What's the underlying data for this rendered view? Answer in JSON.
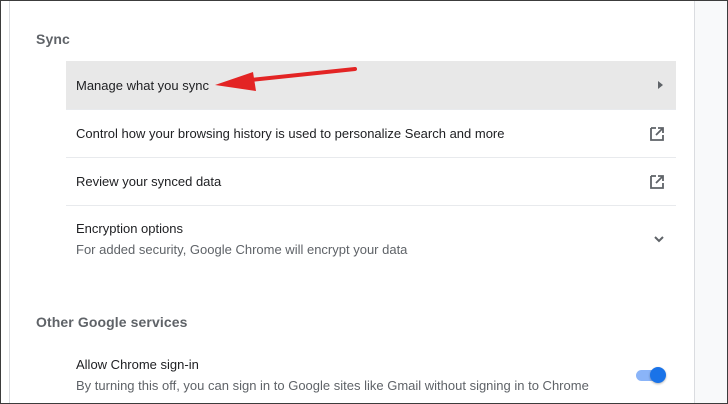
{
  "sync": {
    "heading": "Sync",
    "items": [
      {
        "label": "Manage what you sync",
        "icon": "chevron-right-icon"
      },
      {
        "label": "Control how your browsing history is used to personalize Search and more",
        "icon": "open-in-new-icon"
      },
      {
        "label": "Review your synced data",
        "icon": "open-in-new-icon"
      },
      {
        "label": "Encryption options",
        "sublabel": "For added security, Google Chrome will encrypt your data",
        "icon": "chevron-down-icon"
      }
    ]
  },
  "other_services": {
    "heading": "Other Google services",
    "items": [
      {
        "label": "Allow Chrome sign-in",
        "sublabel": "By turning this off, you can sign in to Google sites like Gmail without signing in to Chrome",
        "toggle_on": true
      }
    ]
  },
  "colors": {
    "accent": "#1a73e8",
    "toggle_track": "#8ab4f8",
    "highlight_row": "#e8e8e8",
    "annotation_arrow": "#e32424"
  }
}
